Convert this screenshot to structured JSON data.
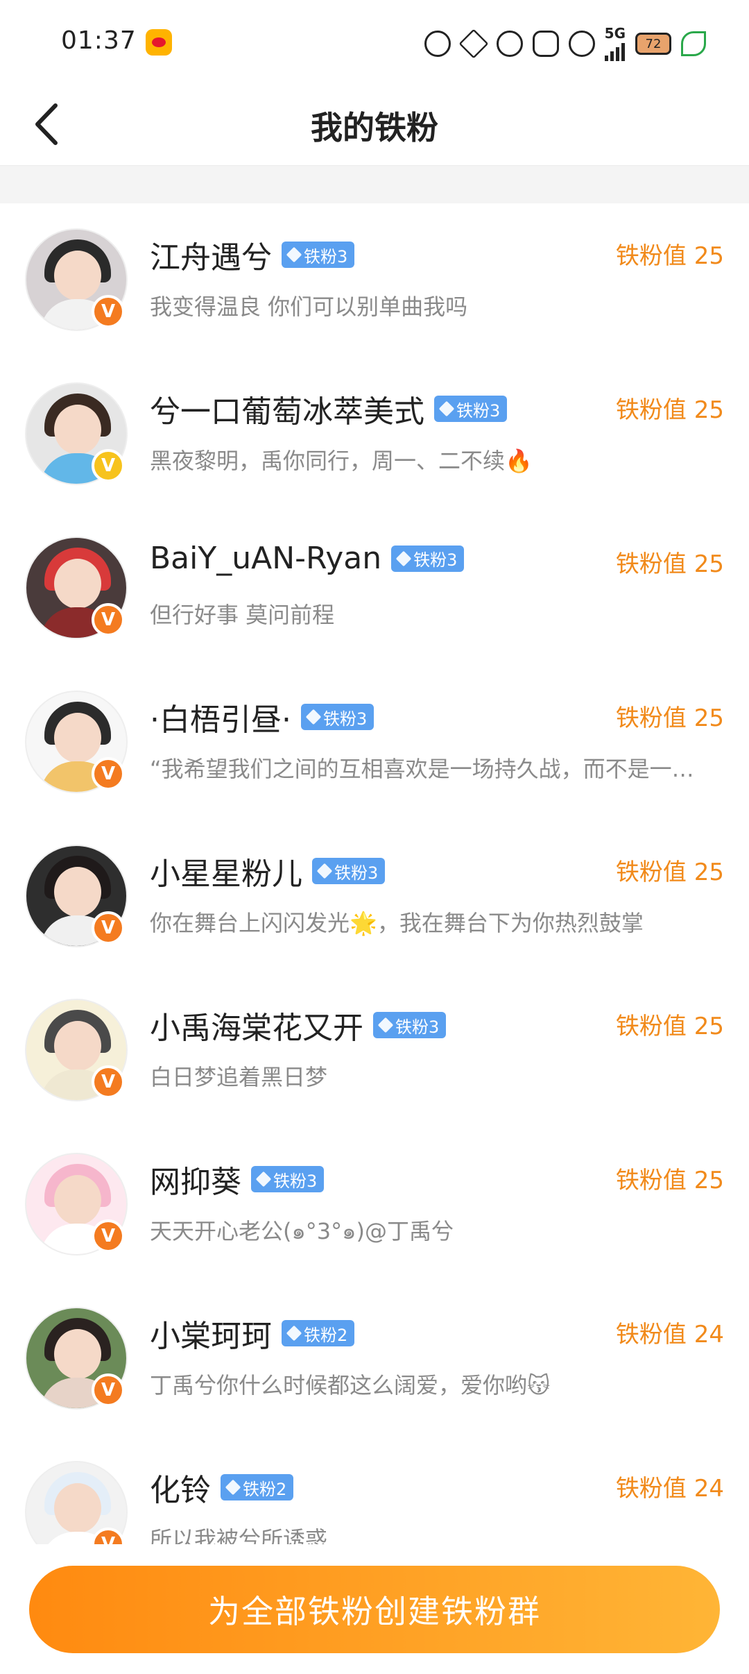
{
  "status_bar": {
    "time": "01:37",
    "network": "5G",
    "battery": "72",
    "icons": [
      "weibo-icon",
      "bear-icon",
      "flower-icon",
      "cat-icon",
      "bow-icon",
      "strawberry-icon",
      "signal-icon",
      "battery-icon",
      "leaf-icon"
    ]
  },
  "header": {
    "title": "我的铁粉",
    "back_icon": "chevron-left-icon"
  },
  "fans": [
    {
      "name": "江舟遇兮",
      "level": "铁粉3",
      "score": "铁粉值 25",
      "bio": "我变得温良 你们可以别单曲我吗",
      "verified_color": "#f47b20",
      "hair": "#2a2a2a",
      "clothes": "#f2f2f2",
      "bg": "#d7d2d4"
    },
    {
      "name": "兮一口葡萄冰萃美式",
      "level": "铁粉3",
      "score": "铁粉值 25",
      "bio": "黑夜黎明，禹你同行，周一、二不续🔥",
      "verified_color": "#f7c31d",
      "hair": "#3a2a22",
      "clothes": "#62b7e8",
      "bg": "#e6e6e6"
    },
    {
      "name": "BaiY_uAN-Ryan",
      "level": "铁粉3",
      "score": "铁粉值 25",
      "bio": "但行好事 莫问前程",
      "verified_color": "#f47b20",
      "hair": "#d83a3a",
      "clothes": "#8b2b2b",
      "bg": "#4a3b3b"
    },
    {
      "name": "·白梧引昼·",
      "level": "铁粉3",
      "score": "铁粉值 25",
      "bio": "“我希望我们之间的互相喜欢是一场持久战，而不是一场闪电战”",
      "verified_color": "#f47b20",
      "hair": "#2b2b2b",
      "clothes": "#f2c46a",
      "bg": "#f7f7f7"
    },
    {
      "name": "小星星粉儿",
      "level": "铁粉3",
      "score": "铁粉值 25",
      "bio": "你在舞台上闪闪发光🌟，我在舞台下为你热烈鼓掌",
      "verified_color": "#f47b20",
      "hair": "#1f1a1a",
      "clothes": "#f0f0f0",
      "bg": "#2e2e2e"
    },
    {
      "name": "小禹海棠花又开",
      "level": "铁粉3",
      "score": "铁粉值 25",
      "bio": "白日梦追着黑日梦",
      "verified_color": "#f47b20",
      "hair": "#4a4a4a",
      "clothes": "#efe8d2",
      "bg": "#f6f0d9"
    },
    {
      "name": "网抑葵",
      "level": "铁粉3",
      "score": "铁粉值 25",
      "bio": "天天开心老公(๑°3°๑)@丁禹兮",
      "verified_color": "#f47b20",
      "hair": "#f6b6cc",
      "clothes": "#ffffff",
      "bg": "#fde8ef"
    },
    {
      "name": "小棠珂珂",
      "level": "铁粉2",
      "score": "铁粉值 24",
      "bio": "丁禹兮你什么时候都这么阔爱，爱你哟😽",
      "verified_color": "#f47b20",
      "hair": "#2a2220",
      "clothes": "#e7d3c8",
      "bg": "#6b8b58"
    },
    {
      "name": "化铃",
      "level": "铁粉2",
      "score": "铁粉值 24",
      "bio": "所以我被兮所诱惑",
      "verified_color": "#f47b20",
      "hair": "#e4eef8",
      "clothes": "#ffffff",
      "bg": "#f2f2f2"
    }
  ],
  "cta": {
    "label": "为全部铁粉创建铁粉群"
  }
}
